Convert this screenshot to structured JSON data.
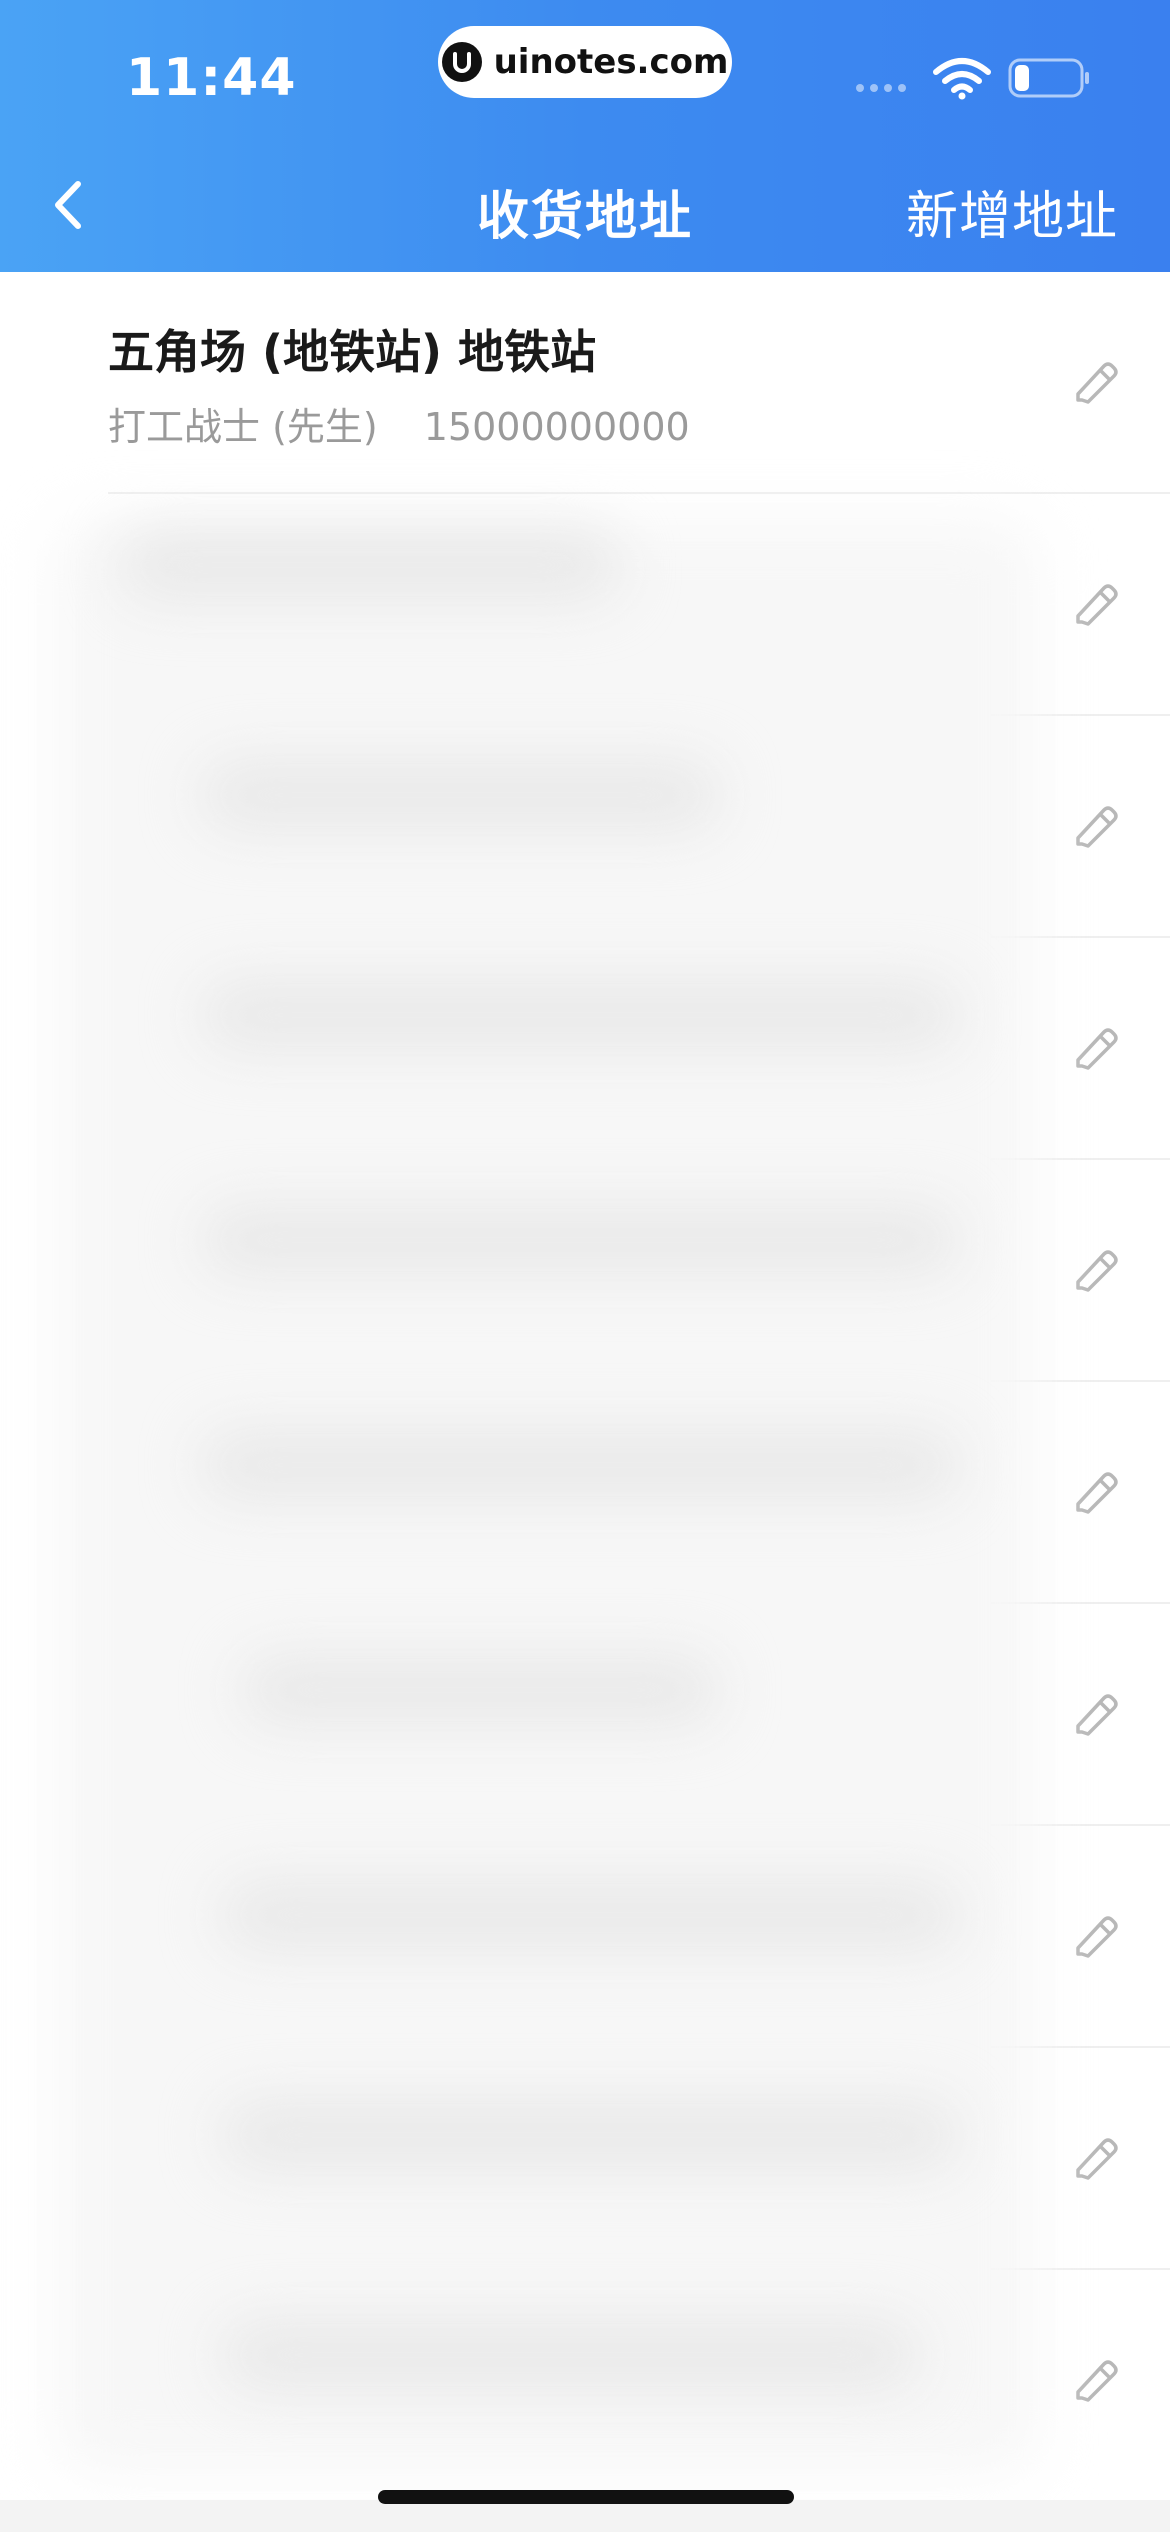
{
  "status_bar": {
    "time": "11:44",
    "site_label": "uinotes.com"
  },
  "nav": {
    "title": "收货地址",
    "add_label": "新增地址"
  },
  "addresses": [
    {
      "name": "五角场 (地铁站) 地铁站",
      "contact": "打工战士 (先生)",
      "phone": "15000000000",
      "blurred": false
    },
    {
      "name": "",
      "contact": "",
      "phone": "",
      "blurred": true
    },
    {
      "name": "",
      "contact": "",
      "phone": "",
      "blurred": true
    },
    {
      "name": "",
      "contact": "",
      "phone": "",
      "blurred": true
    },
    {
      "name": "",
      "contact": "",
      "phone": "",
      "blurred": true
    },
    {
      "name": "",
      "contact": "",
      "phone": "",
      "blurred": true
    },
    {
      "name": "",
      "contact": "",
      "phone": "",
      "blurred": true
    },
    {
      "name": "",
      "contact": "",
      "phone": "",
      "blurred": true
    },
    {
      "name": "",
      "contact": "",
      "phone": "",
      "blurred": true
    },
    {
      "name": "",
      "contact": "",
      "phone": "",
      "blurred": true
    }
  ],
  "icons": {
    "back": "chevron-left-icon",
    "edit": "pencil-icon",
    "wifi": "wifi-icon",
    "battery": "battery-icon"
  },
  "colors": {
    "header_start": "#4aa3f5",
    "header_end": "#3a80ef",
    "secondary_text": "#9a9a9a"
  }
}
